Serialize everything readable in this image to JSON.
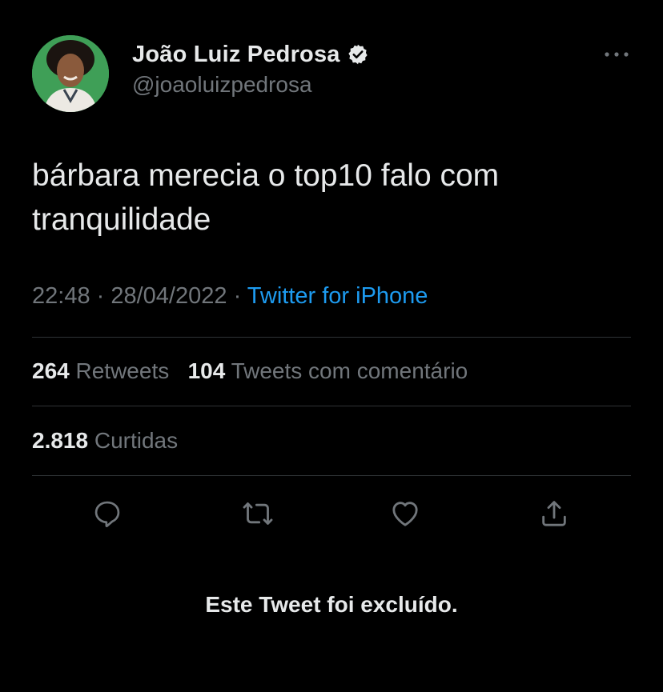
{
  "author": {
    "display_name": "João Luiz Pedrosa",
    "handle": "@joaoluizpedrosa",
    "verified": true,
    "avatar_icon": "user-avatar"
  },
  "tweet": {
    "text_line1": "bárbara merecia o top10 falo com",
    "text_line2": "tranquilidade",
    "time": "22:48",
    "sep1": " · ",
    "date": "28/04/2022",
    "sep2": " · ",
    "source": "Twitter for iPhone"
  },
  "stats": {
    "retweets_count": "264",
    "retweets_label": "Retweets",
    "quotes_count": "104",
    "quotes_label": "Tweets com comentário",
    "likes_count": "2.818",
    "likes_label": "Curtidas"
  },
  "actions": {
    "reply_icon": "reply-icon",
    "retweet_icon": "retweet-icon",
    "like_icon": "like-icon",
    "share_icon": "share-icon"
  },
  "menu_icon": "more-icon",
  "deleted_notice": "Este Tweet foi excluído.",
  "colors": {
    "background": "#000000",
    "primary_text": "#e7e9ea",
    "secondary_text": "#71767b",
    "accent": "#1d9bf0",
    "divider": "#2f3336"
  }
}
